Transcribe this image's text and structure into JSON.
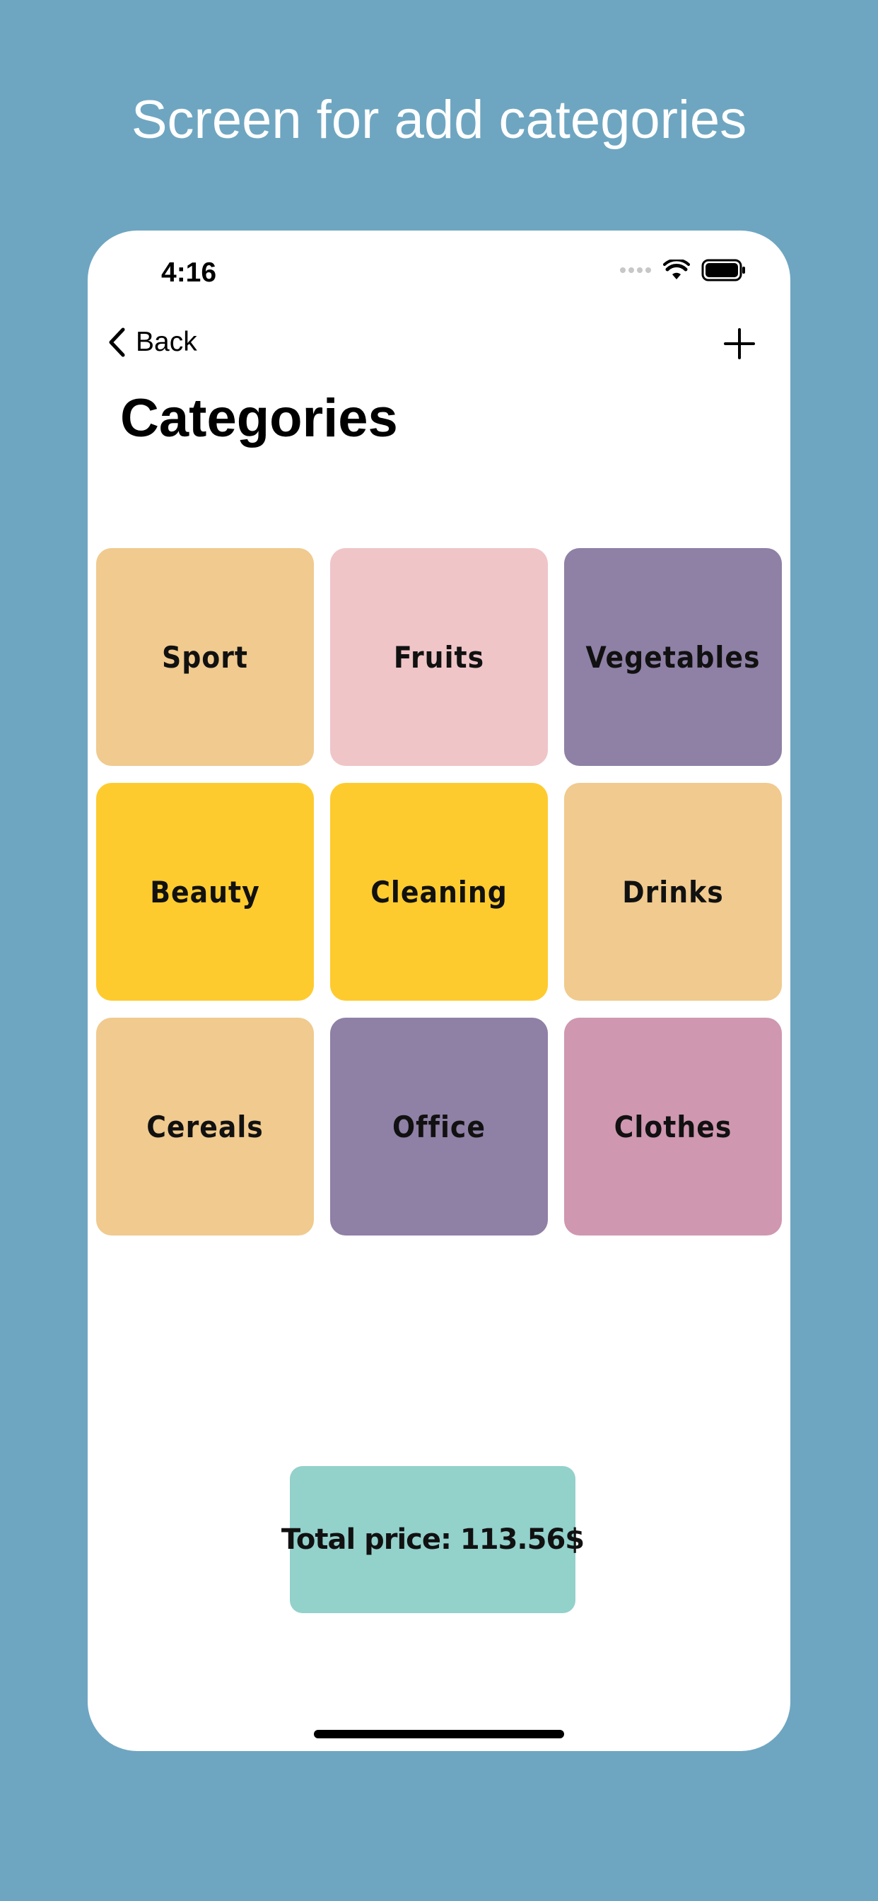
{
  "headline": "Screen for add categories",
  "status_bar": {
    "time": "4:16",
    "icons": [
      "signal-icon",
      "wifi-icon",
      "battery-icon"
    ]
  },
  "nav": {
    "back_label": "Back",
    "back_icon": "chevron-left-icon",
    "add_icon": "plus-icon"
  },
  "page_title": "Categories",
  "categories": [
    {
      "label": "Sport",
      "color": "#f0ca8e"
    },
    {
      "label": "Fruits",
      "color": "#efc5c7"
    },
    {
      "label": "Vegetables",
      "color": "#8f80a6"
    },
    {
      "label": "Beauty",
      "color": "#fecb2f"
    },
    {
      "label": "Cleaning",
      "color": "#fecb2f"
    },
    {
      "label": "Drinks",
      "color": "#f0ca8e"
    },
    {
      "label": "Cereals",
      "color": "#f0ca8e"
    },
    {
      "label": "Office",
      "color": "#8f80a6"
    },
    {
      "label": "Clothes",
      "color": "#cf97b0"
    }
  ],
  "total": {
    "label": "Total price: 113.56$",
    "color": "#93d1cb"
  },
  "colors": {
    "background": "#6ea6c1",
    "screen": "#ffffff"
  }
}
